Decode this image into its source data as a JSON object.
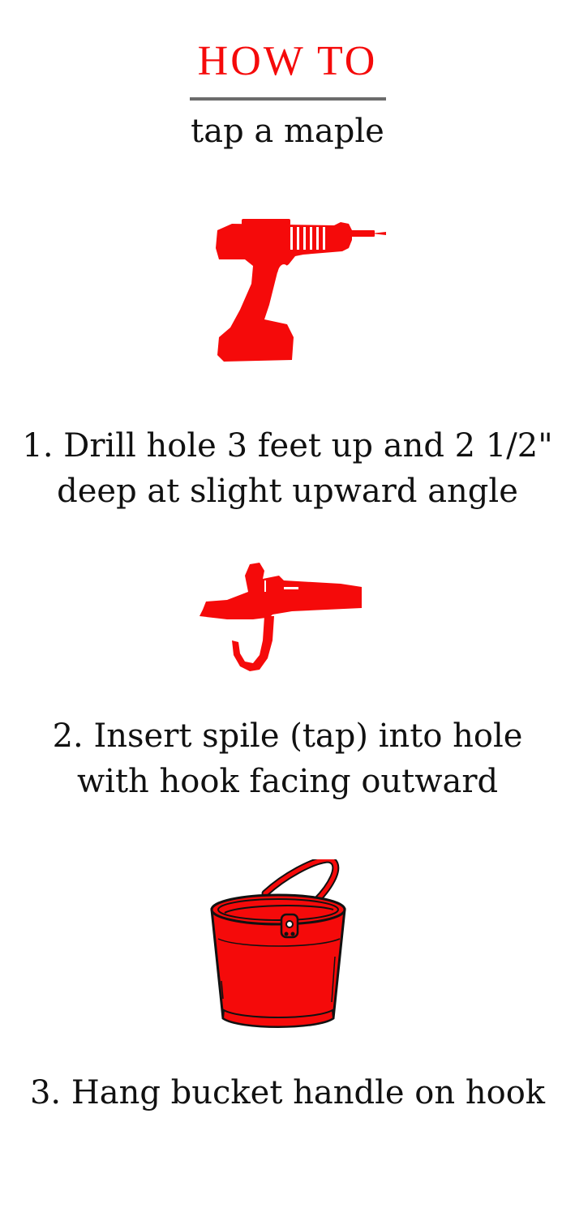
{
  "header": {
    "title": "HOW TO",
    "subtitle": "tap a maple"
  },
  "colors": {
    "accent": "#f50a0a",
    "rule": "#6b6b6b",
    "text": "#111111"
  },
  "steps": [
    {
      "text": "1. Drill hole 3 feet up and 2 1/2\" deep at slight upward angle",
      "icon": "drill-icon"
    },
    {
      "text": "2. Insert spile (tap) into hole with hook facing outward",
      "icon": "spile-icon"
    },
    {
      "text": "3. Hang bucket handle on hook",
      "icon": "bucket-icon"
    }
  ]
}
